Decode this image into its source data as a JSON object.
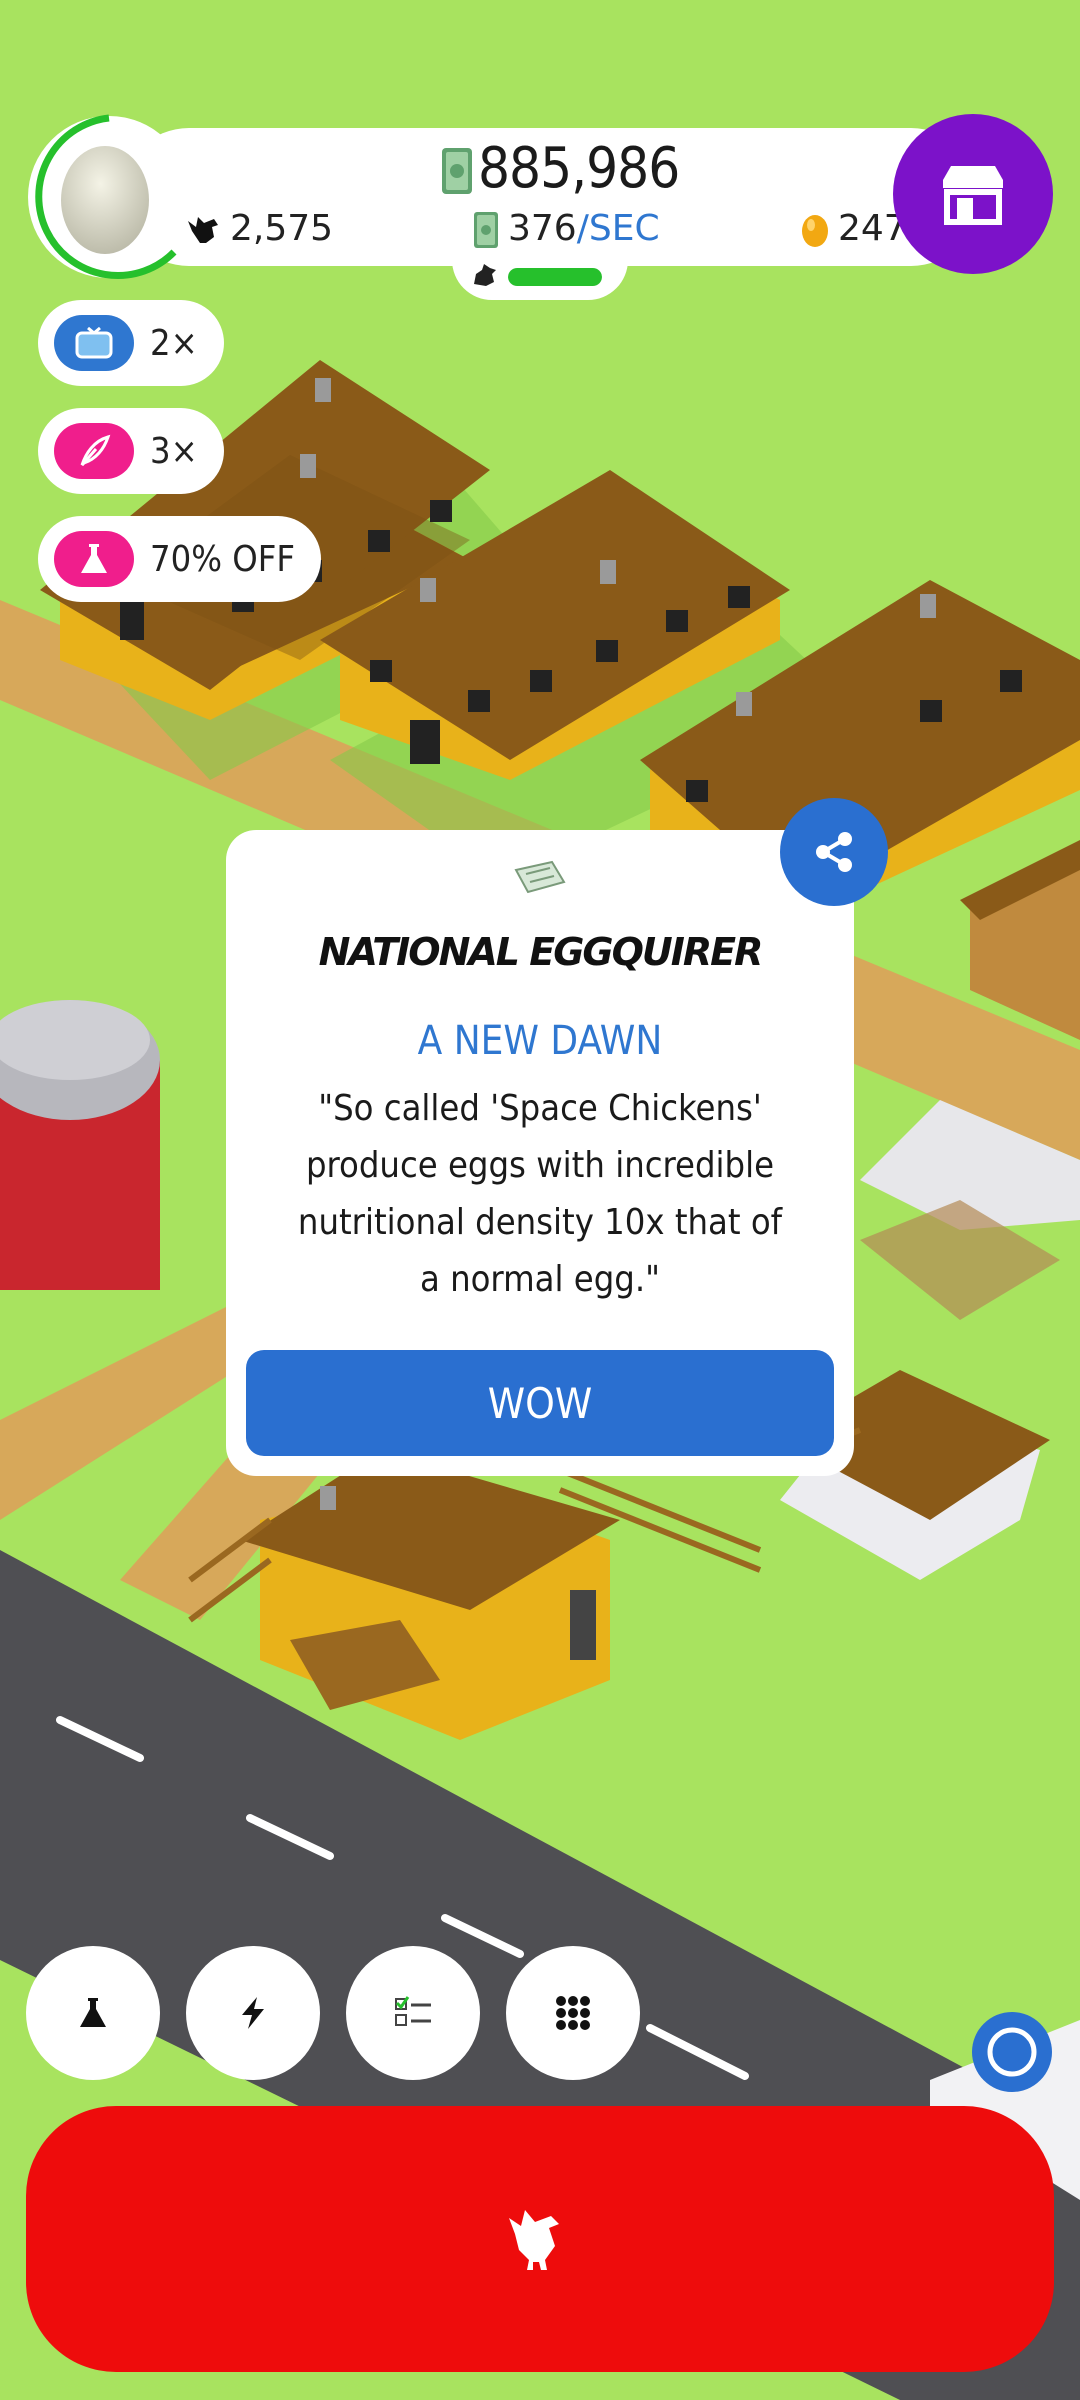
{
  "stats": {
    "money": "885,986",
    "rate_value": "376",
    "rate_unit": "/SEC",
    "chicken_count": "2,575",
    "golden_eggs": "247",
    "hatch_progress_percent": 100
  },
  "boosts": [
    {
      "label": "2×",
      "icon": "tv-ad-icon",
      "color": "#2f77d0"
    },
    {
      "label": "3×",
      "icon": "feather-quill-icon",
      "color": "#f01e8c"
    },
    {
      "label": "70% OFF",
      "icon": "flask-icon",
      "color": "#f01e8c"
    }
  ],
  "news": {
    "title": "NATIONAL EGGQUIRER",
    "headline": "A NEW DAWN",
    "body": "\"So called 'Space Chickens' produce eggs with incredible nutritional density 10x that of a normal egg.\"",
    "button_label": "WOW"
  },
  "bottom_buttons": [
    "flask-icon",
    "lightning-icon",
    "checklist-icon",
    "grid-menu-icon"
  ],
  "colors": {
    "grass": "#a8e35f",
    "shop": "#7c12c9",
    "hatch": "#ee0c0c",
    "accent_blue": "#2a6fd0",
    "progress_green": "#26c02c"
  }
}
